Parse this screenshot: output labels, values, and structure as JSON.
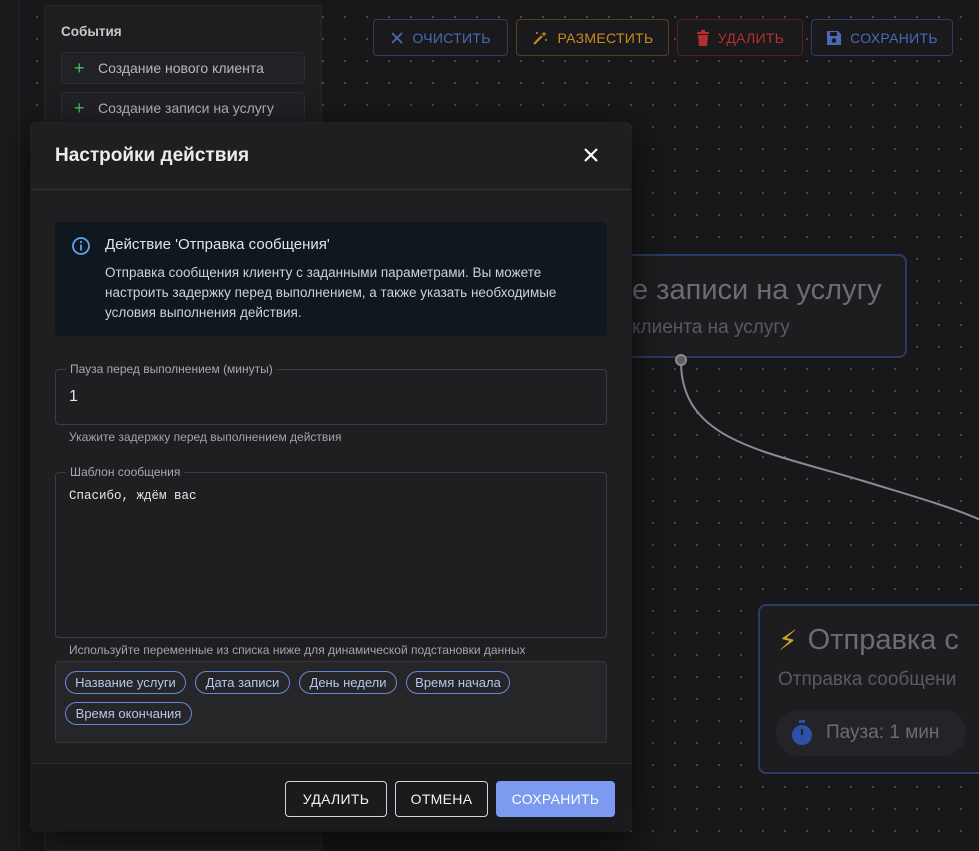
{
  "sidebar": {
    "title": "События",
    "items": [
      {
        "label": "Создание нового клиента"
      },
      {
        "label": "Создание записи на услугу"
      }
    ]
  },
  "toolbar": {
    "clear_label": "ОЧИСТИТЬ",
    "place_label": "РАЗМЕСТИТЬ",
    "delete_label": "УДАЛИТЬ",
    "save_label": "СОХРАНИТЬ"
  },
  "canvas": {
    "node_event": {
      "title": "е записи на услугу",
      "subtitle": "клиента на услугу"
    },
    "node_action": {
      "title": "Отправка с",
      "subtitle": "Отправка сообщени",
      "pause_label": "Пауза: 1 мин"
    }
  },
  "modal": {
    "title": "Настройки действия",
    "info": {
      "title": "Действие 'Отправка сообщения'",
      "text": "Отправка сообщения клиенту с заданными параметрами. Вы можете настроить задержку перед выполнением, а также указать необходимые условия выполнения действия."
    },
    "pause_field": {
      "label": "Пауза перед выполнением (минуты)",
      "value": "1",
      "helper": "Укажите задержку перед выполнением действия"
    },
    "template_field": {
      "label": "Шаблон сообщения",
      "value": "Спасибо, ждём вас",
      "helper": "Используйте переменные из списка ниже для динамической подстановки данных"
    },
    "variables": [
      "Название услуги",
      "Дата записи",
      "День недели",
      "Время начала",
      "Время окончания"
    ],
    "footer": {
      "delete_label": "УДАЛИТЬ",
      "cancel_label": "ОТМЕНА",
      "save_label": "СОХРАНИТЬ"
    }
  },
  "colors": {
    "accent": "#7c9bf0",
    "success": "#3fbf6a",
    "warning": "#c88a1e",
    "danger": "#b3302e"
  }
}
